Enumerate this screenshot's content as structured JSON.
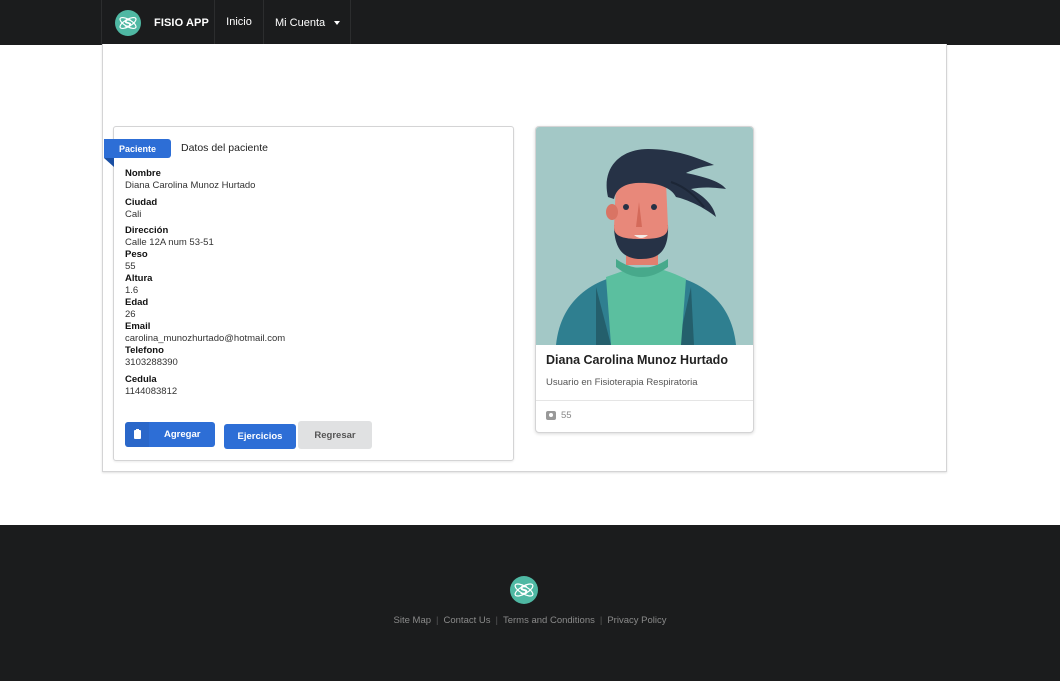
{
  "header": {
    "brand": "FISIO APP",
    "nav": {
      "home": "Inicio",
      "account": "Mi Cuenta"
    }
  },
  "patient": {
    "ribbon": "Paciente",
    "heading": "Datos del paciente",
    "fields": [
      {
        "label": "Nombre",
        "value": "Diana Carolina Munoz Hurtado"
      },
      {
        "label": "Ciudad",
        "value": "Cali"
      },
      {
        "label": "Dirección",
        "value": "Calle 12A num 53-51"
      },
      {
        "label": "Peso",
        "value": "55"
      },
      {
        "label": "Altura",
        "value": "1.6"
      },
      {
        "label": "Edad",
        "value": "26"
      },
      {
        "label": "Email",
        "value": "carolina_munozhurtado@hotmail.com"
      },
      {
        "label": "Telefono",
        "value": "3103288390"
      },
      {
        "label": "Cedula",
        "value": "1144083812"
      }
    ],
    "buttons": {
      "add": "Agregar",
      "exercises": "Ejercicios",
      "back": "Regresar"
    }
  },
  "profile": {
    "name": "Diana Carolina Munoz Hurtado",
    "meta": "Usuario en Fisioterapia Respiratoria",
    "extra": "55"
  },
  "footer": {
    "links": [
      "Site Map",
      "Contact Us",
      "Terms and Conditions",
      "Privacy Policy"
    ]
  },
  "colors": {
    "primary": "#2d6ed6",
    "dark": "#1b1c1d",
    "logo": "#4fb8a3",
    "avatar_bg": "#a3c8c6"
  }
}
